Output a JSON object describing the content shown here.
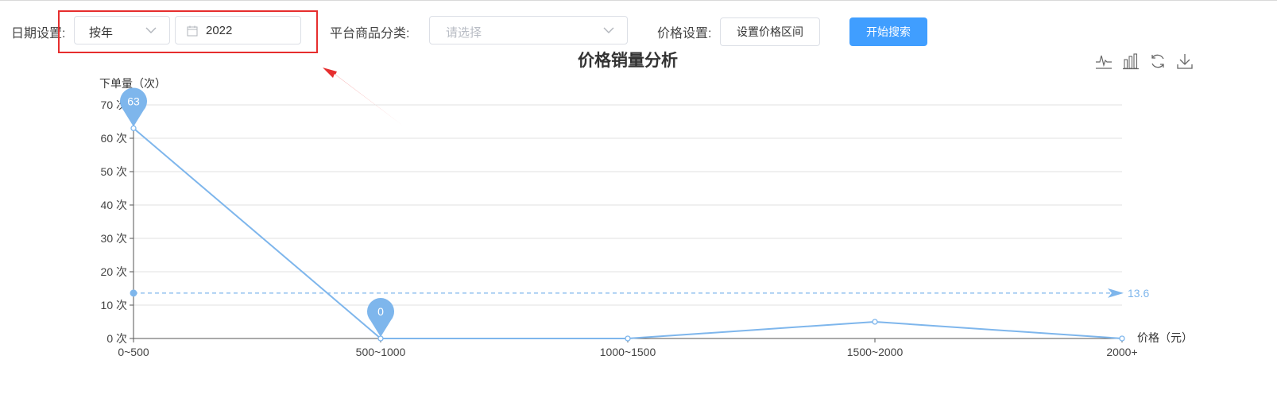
{
  "filters": {
    "date_label": "日期设置:",
    "date_mode_value": "按年",
    "date_year_value": "2022",
    "category_label": "平台商品分类:",
    "category_placeholder": "请选择",
    "price_label": "价格设置:",
    "price_range_button": "设置价格区间",
    "search_button": "开始搜索"
  },
  "colors": {
    "accent": "#409eff",
    "series": "#7eb6ec",
    "annotation": "#e62e2e"
  },
  "toolbox": [
    "line-chart-icon",
    "bar-chart-icon",
    "refresh-icon",
    "download-icon"
  ],
  "chart_data": {
    "type": "line",
    "title": "价格销量分析",
    "ylabel": "下单量（次）",
    "xlabel": "价格（元）",
    "categories": [
      "0~500",
      "500~1000",
      "1000~1500",
      "1500~2000",
      "2000+"
    ],
    "ylim": [
      0,
      70
    ],
    "yticks": [
      0,
      10,
      20,
      30,
      40,
      50,
      60,
      70
    ],
    "ytick_suffix": " 次",
    "series": [
      {
        "values": [
          63,
          0,
          0,
          5,
          0
        ]
      }
    ],
    "mark_points": [
      {
        "category": "0~500",
        "value": 63,
        "label": "63"
      },
      {
        "category": "500~1000",
        "value": 0,
        "label": "0"
      }
    ],
    "mark_line": {
      "value": 13.6,
      "label": "13.6",
      "type": "average"
    },
    "grid": true
  }
}
